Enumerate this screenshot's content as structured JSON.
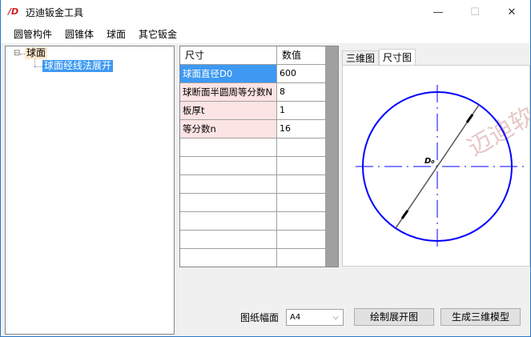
{
  "window": {
    "title": "迈迪钣金工具",
    "logo": "迈迪 logo",
    "minimize": "—",
    "maximize": "☐",
    "close": "✕"
  },
  "menu": [
    "圆管构件",
    "圆锥体",
    "球面",
    "其它钣金"
  ],
  "tree": {
    "root": "球面",
    "expander": "⊟",
    "child": "球面经线法展开"
  },
  "grid": {
    "headers": [
      "尺寸",
      "数值"
    ],
    "rows": [
      {
        "name": "球面直径D0",
        "value": "600"
      },
      {
        "name": "球断面半圆周等分数N",
        "value": "8"
      },
      {
        "name": "板厚t",
        "value": "1"
      },
      {
        "name": "等分数n",
        "value": "16"
      }
    ],
    "empty_rows": 7
  },
  "tabs": [
    "三维图",
    "尺寸图"
  ],
  "drawing": {
    "dimension_label": "D₀",
    "watermark": "迈迪软件"
  },
  "bottom": {
    "paper_label": "图纸幅面",
    "paper_value": "A4",
    "draw_button": "绘制展开图",
    "model_button": "生成三维模型"
  }
}
